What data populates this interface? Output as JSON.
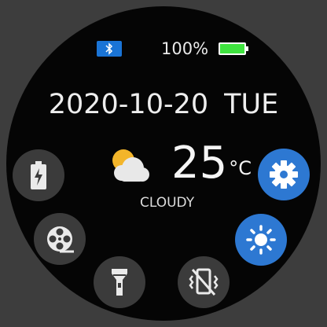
{
  "status": {
    "bluetooth_icon": "bluetooth-icon",
    "battery_percent": "100%",
    "battery_icon": "battery-full-icon"
  },
  "date": {
    "date": "2020-10-20",
    "weekday": "TUE"
  },
  "weather": {
    "icon": "partly-cloudy-icon",
    "temperature": "25",
    "unit": "°C",
    "condition": "CLOUDY"
  },
  "quick_actions": [
    {
      "icon": "battery-saver-icon",
      "active": false
    },
    {
      "icon": "film-reel-icon",
      "active": false
    },
    {
      "icon": "flashlight-icon",
      "active": false
    },
    {
      "icon": "vibrate-off-icon",
      "active": false
    },
    {
      "icon": "brightness-icon",
      "active": true
    },
    {
      "icon": "settings-gear-icon",
      "active": true
    }
  ],
  "colors": {
    "accent": "#2d78d2",
    "button_inactive": "#3b3b3b",
    "battery_green": "#3fe33f",
    "background": "#050505"
  }
}
